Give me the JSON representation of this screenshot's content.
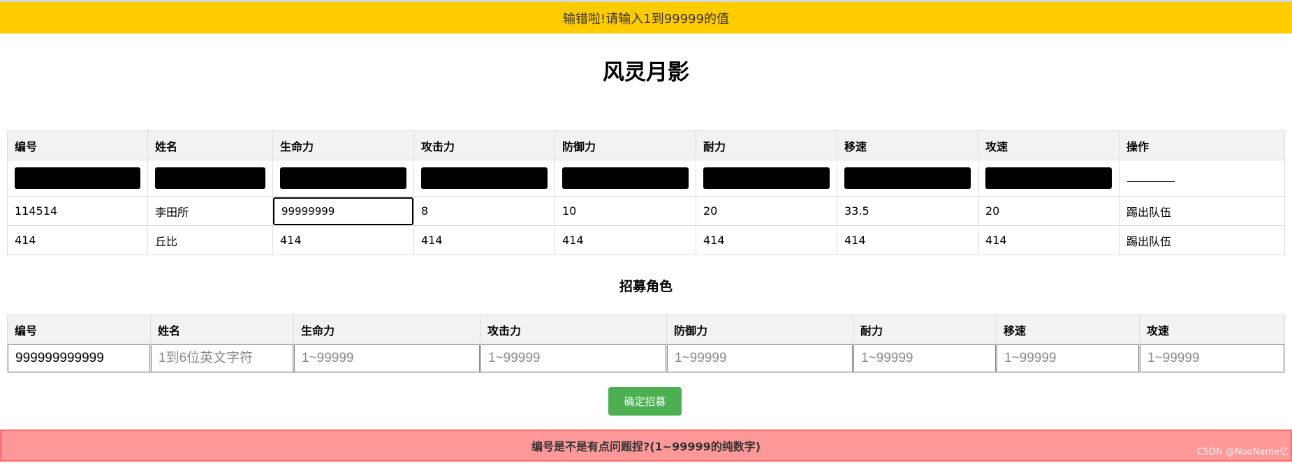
{
  "warning_banner": "输错啦!请输入1到99999的值",
  "title": "风灵月影",
  "team_table": {
    "headers": [
      "编号",
      "姓名",
      "生命力",
      "攻击力",
      "防御力",
      "耐力",
      "移速",
      "攻速",
      "操作"
    ],
    "mask_row_action": "————",
    "rows": [
      {
        "id": "114514",
        "name": "李田所",
        "hp": "99999999",
        "atk": "8",
        "def": "10",
        "stamina": "20",
        "speed": "33.5",
        "atk_speed": "20",
        "action": "踢出队伍"
      },
      {
        "id": "414",
        "name": "丘比",
        "hp": "414",
        "atk": "414",
        "def": "414",
        "stamina": "414",
        "speed": "414",
        "atk_speed": "414",
        "action": "踢出队伍"
      }
    ]
  },
  "recruit": {
    "title": "招募角色",
    "headers": [
      "编号",
      "姓名",
      "生命力",
      "攻击力",
      "防御力",
      "耐力",
      "移速",
      "攻速"
    ],
    "id_value": "999999999999",
    "name_placeholder": "1到6位英文字符",
    "num_placeholder": "1~99999",
    "button_label": "确定招募"
  },
  "error_banner": "编号是不是有点问题捏?(1~99999的纯数字)",
  "watermark": "CSDN @NooName亿"
}
